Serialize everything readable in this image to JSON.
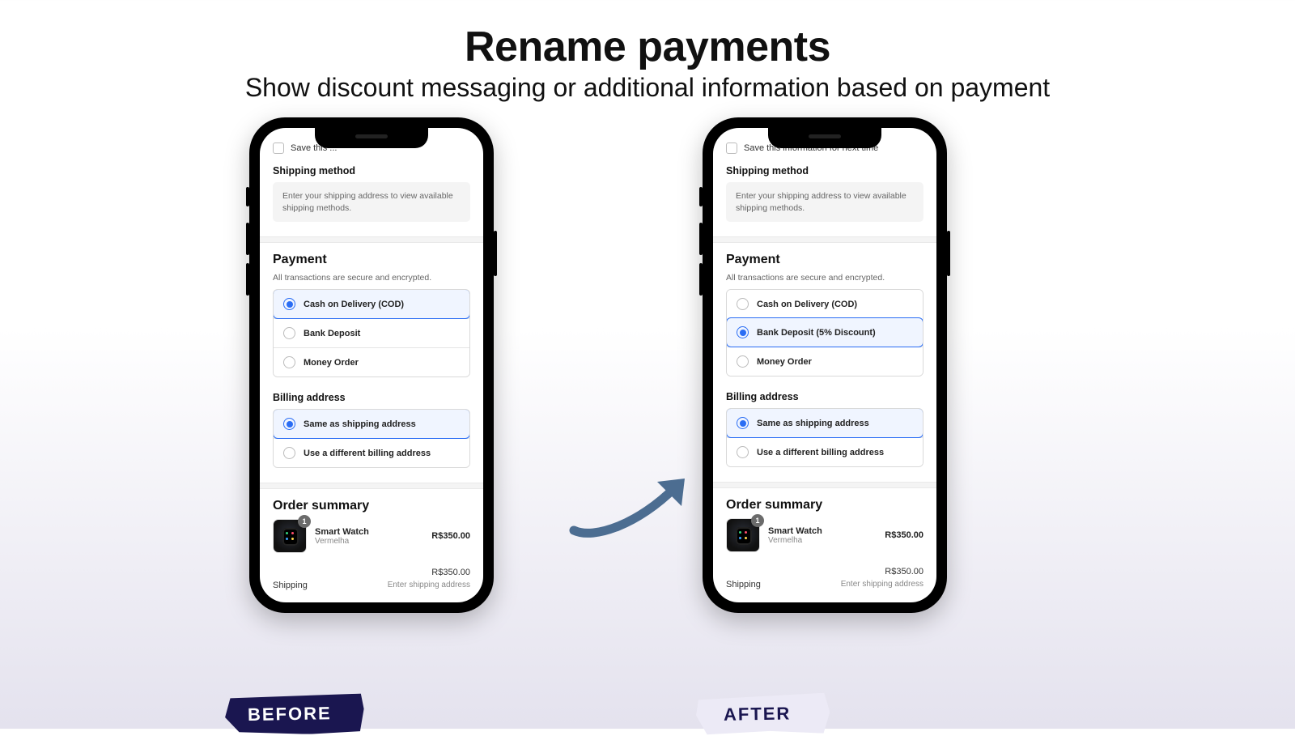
{
  "headline": {
    "title": "Rename payments",
    "subtitle": "Show discount messaging or additional information based on payment"
  },
  "tags": {
    "before": "BEFORE",
    "after": "AFTER"
  },
  "common": {
    "save_info": "Save this information for next time",
    "shipping_method_title": "Shipping method",
    "shipping_note": "Enter your shipping address to view available shipping methods.",
    "payment_title": "Payment",
    "payment_sub": "All transactions are secure and encrypted.",
    "billing_title": "Billing address",
    "billing_same": "Same as shipping address",
    "billing_diff": "Use a different billing address",
    "order_summary_title": "Order summary",
    "product_name": "Smart Watch",
    "product_variant": "Vermelha",
    "product_qty": "1",
    "product_price": "R$350.00",
    "subtotal_value": "R$350.00",
    "shipping_label": "Shipping",
    "shipping_value": "Enter shipping address"
  },
  "before": {
    "save_partial": "Save this ...",
    "options": [
      {
        "label": "Cash on Delivery (COD)",
        "selected": true
      },
      {
        "label": "Bank Deposit",
        "selected": false
      },
      {
        "label": "Money Order",
        "selected": false
      }
    ]
  },
  "after": {
    "options": [
      {
        "label": "Cash on Delivery (COD)",
        "selected": false
      },
      {
        "label": "Bank Deposit (5% Discount)",
        "selected": true
      },
      {
        "label": "Money Order",
        "selected": false
      }
    ]
  }
}
